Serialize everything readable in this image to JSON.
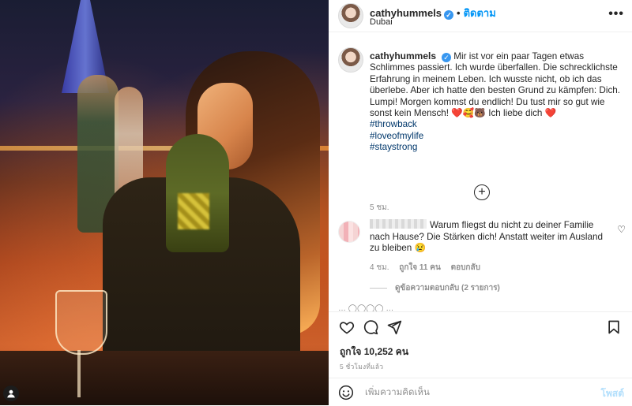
{
  "post": {
    "username": "cathyhummels",
    "follow_label": "ติดตาม",
    "location": "Dubai",
    "more_label": "•••",
    "verified_icon": "verified-icon",
    "caption_lines": [
      "Mir ist vor ein paar Tagen etwas Schlimmes passiert. Ich wurde überfallen. Die schrecklichste Erfahrung in meinem Leben. Ich wusste nicht, ob ich das überlebe. Aber ich hatte den besten Grund zu kämpfen: Dich. Lumpi! Morgen kommst du endlich! Du tust mir so gut wie sonst kein Mensch! ",
      " Ich liebe dich "
    ],
    "caption_emojis": "❤️🥰🐻",
    "caption_heart": "❤️",
    "hashtags": [
      "#throwback",
      "#loveofmylife",
      "#staystrong"
    ],
    "caption_time": "5 ชม.",
    "load_more": "+"
  },
  "comment": {
    "text": "Warum fliegst du nicht zu deiner Familie nach Hause? Die Stärken dich! Anstatt weiter im Ausland zu bleiben",
    "emoji": "😢",
    "time": "4 ชม.",
    "likes": "ถูกใจ 11 คน",
    "reply": "ตอบกลับ",
    "view_replies": "ดูข้อความตอบกลับ (2 รายการ)",
    "heart": "♡"
  },
  "next_comment_preview": "… ◯◯◯◯ …",
  "actions": {
    "likes_count": "ถูกใจ 10,252 คน",
    "post_time": "5 ชั่วโมงที่แล้ว"
  },
  "add_comment": {
    "placeholder": "เพิ่มความคิดเห็น",
    "post_label": "โพสต์"
  },
  "colors": {
    "accent": "#0095f6",
    "hashtag": "#00376b",
    "muted": "#8e8e8e",
    "post_disabled": "#b2dffc"
  }
}
